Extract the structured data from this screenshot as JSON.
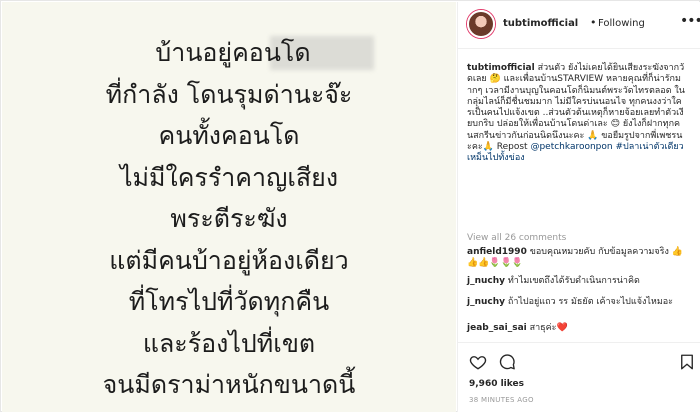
{
  "photo": {
    "lines": [
      "บ้านอยู่คอนโด",
      "ที่กำลัง โดนรุมด่านะจ๊ะ",
      "คนทั้งคอนโด",
      "ไม่มีใครรำคาญเสียง",
      "พระตีระฆัง",
      "แต่มีคนบ้าอยู่ห้องเดียว",
      "ที่โทรไปที่วัดทุกคืน",
      "และร้องไปที่เขต",
      "จนมีดราม่าหนักขนาดนี้"
    ]
  },
  "header": {
    "username": "tubtimofficial",
    "separator": "•",
    "follow_status": "Following",
    "more_label": "•••"
  },
  "caption": {
    "username": "tubtimofficial",
    "text_part1": " ส่วนตัว ยังไม่เคยได้ยินเสียงระฆังจากวัดเลย 🤔 และเพื่อนบ้านSTARVIEW หลายคุณที่ก็น่ารักมากๆ เวลามีงานบุญในคอนโดก็นิมนต์พระวัดไทรตลอด ในกลุ่มไลน์ก็มีชื่นชมมาก ไม่มีใครบ่นนอนไจ ทุกคนงงว่าใครเป็นคนไปแจ้งเขต ..ส่วนตัวต้นเหตุก็หายจ้อยเลยทำตัวเงียบกริบ ปล่อยให้เพื่อนบ้านโดนด่าเละ 😊 ยังไงก็ฝากทุกคนสกรีนข่าวกันก่อนนิดนึงนะคะ 🙏 ขอยืมรูปจากพี่เพชรนะคะ🙏 Repost ",
    "mention": "@petchkaroonpon",
    "hashtag": " #ปลาเน่าตัวเดียวเหม็นไปทั้งข่อง"
  },
  "view_all_comments": "View all 26 comments",
  "comments": [
    {
      "username": "anfield1990",
      "text": " ขอบคุณหมวยคับ กับข้อมูลความจริง 👍👍👍🌷🌷🌷"
    },
    {
      "username": "j_nuchy",
      "text": " ทำไมเขตถึงได้รับดำเนินการน่าคิด"
    },
    {
      "username": "j_nuchy",
      "text": " ถ้าไปอยู่แถว รร มัธยัต เค้าจะไปแจ้งไหมอะ"
    },
    {
      "username": "jeab_sai_sai",
      "text": " สาธุค่ะ❤️"
    }
  ],
  "actions": {
    "likes": "9,960 likes",
    "timestamp": "38 MINUTES AGO"
  },
  "colors": {
    "photo_bg": "#f7f7ee",
    "text": "#262626",
    "link": "#003569",
    "muted": "#999999",
    "border": "#efefef"
  },
  "icons": [
    "avatar",
    "heart-icon",
    "comment-icon",
    "bookmark-icon"
  ]
}
